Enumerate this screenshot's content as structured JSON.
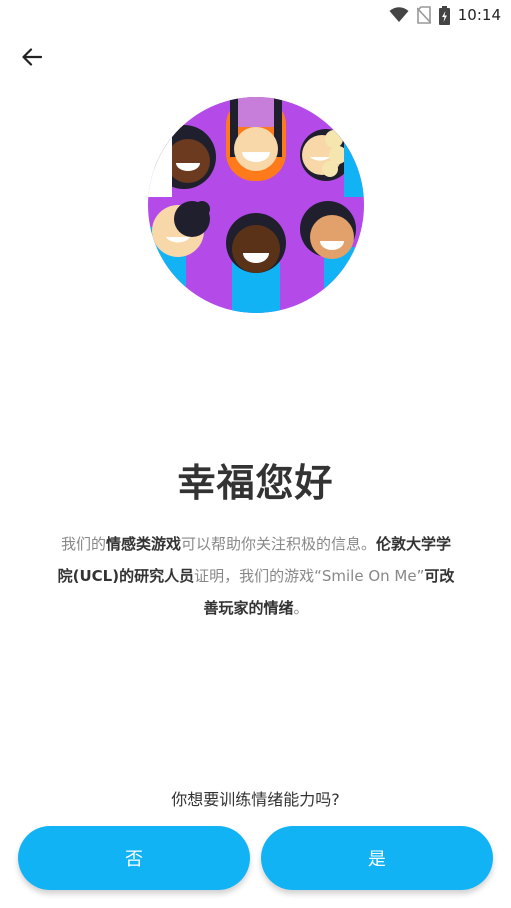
{
  "status_bar": {
    "time": "10:14",
    "icons": [
      "wifi-icon",
      "no-sim-icon",
      "battery-charging-icon"
    ]
  },
  "nav": {
    "back_icon": "arrow-left-icon"
  },
  "hero": {
    "icon": "group-of-smiling-people-illustration",
    "background_color": "#b44be8"
  },
  "content": {
    "title": "幸福您好",
    "body_parts": [
      {
        "text": "我们的",
        "bold": false
      },
      {
        "text": "情感类游戏",
        "bold": true
      },
      {
        "text": "可以帮助你关注积极的信息。",
        "bold": false
      },
      {
        "text": "伦敦大学学院(UCL)的研究人员",
        "bold": true
      },
      {
        "text": "证明，我们的游戏“Smile On Me”",
        "bold": false
      },
      {
        "text": "可改善玩家的情绪",
        "bold": true
      },
      {
        "text": "。",
        "bold": false
      }
    ],
    "question": "你想要训练情绪能力吗?"
  },
  "actions": {
    "no_label": "否",
    "yes_label": "是"
  },
  "colors": {
    "accent": "#12b3f5",
    "title": "#333333",
    "body": "#888888"
  }
}
